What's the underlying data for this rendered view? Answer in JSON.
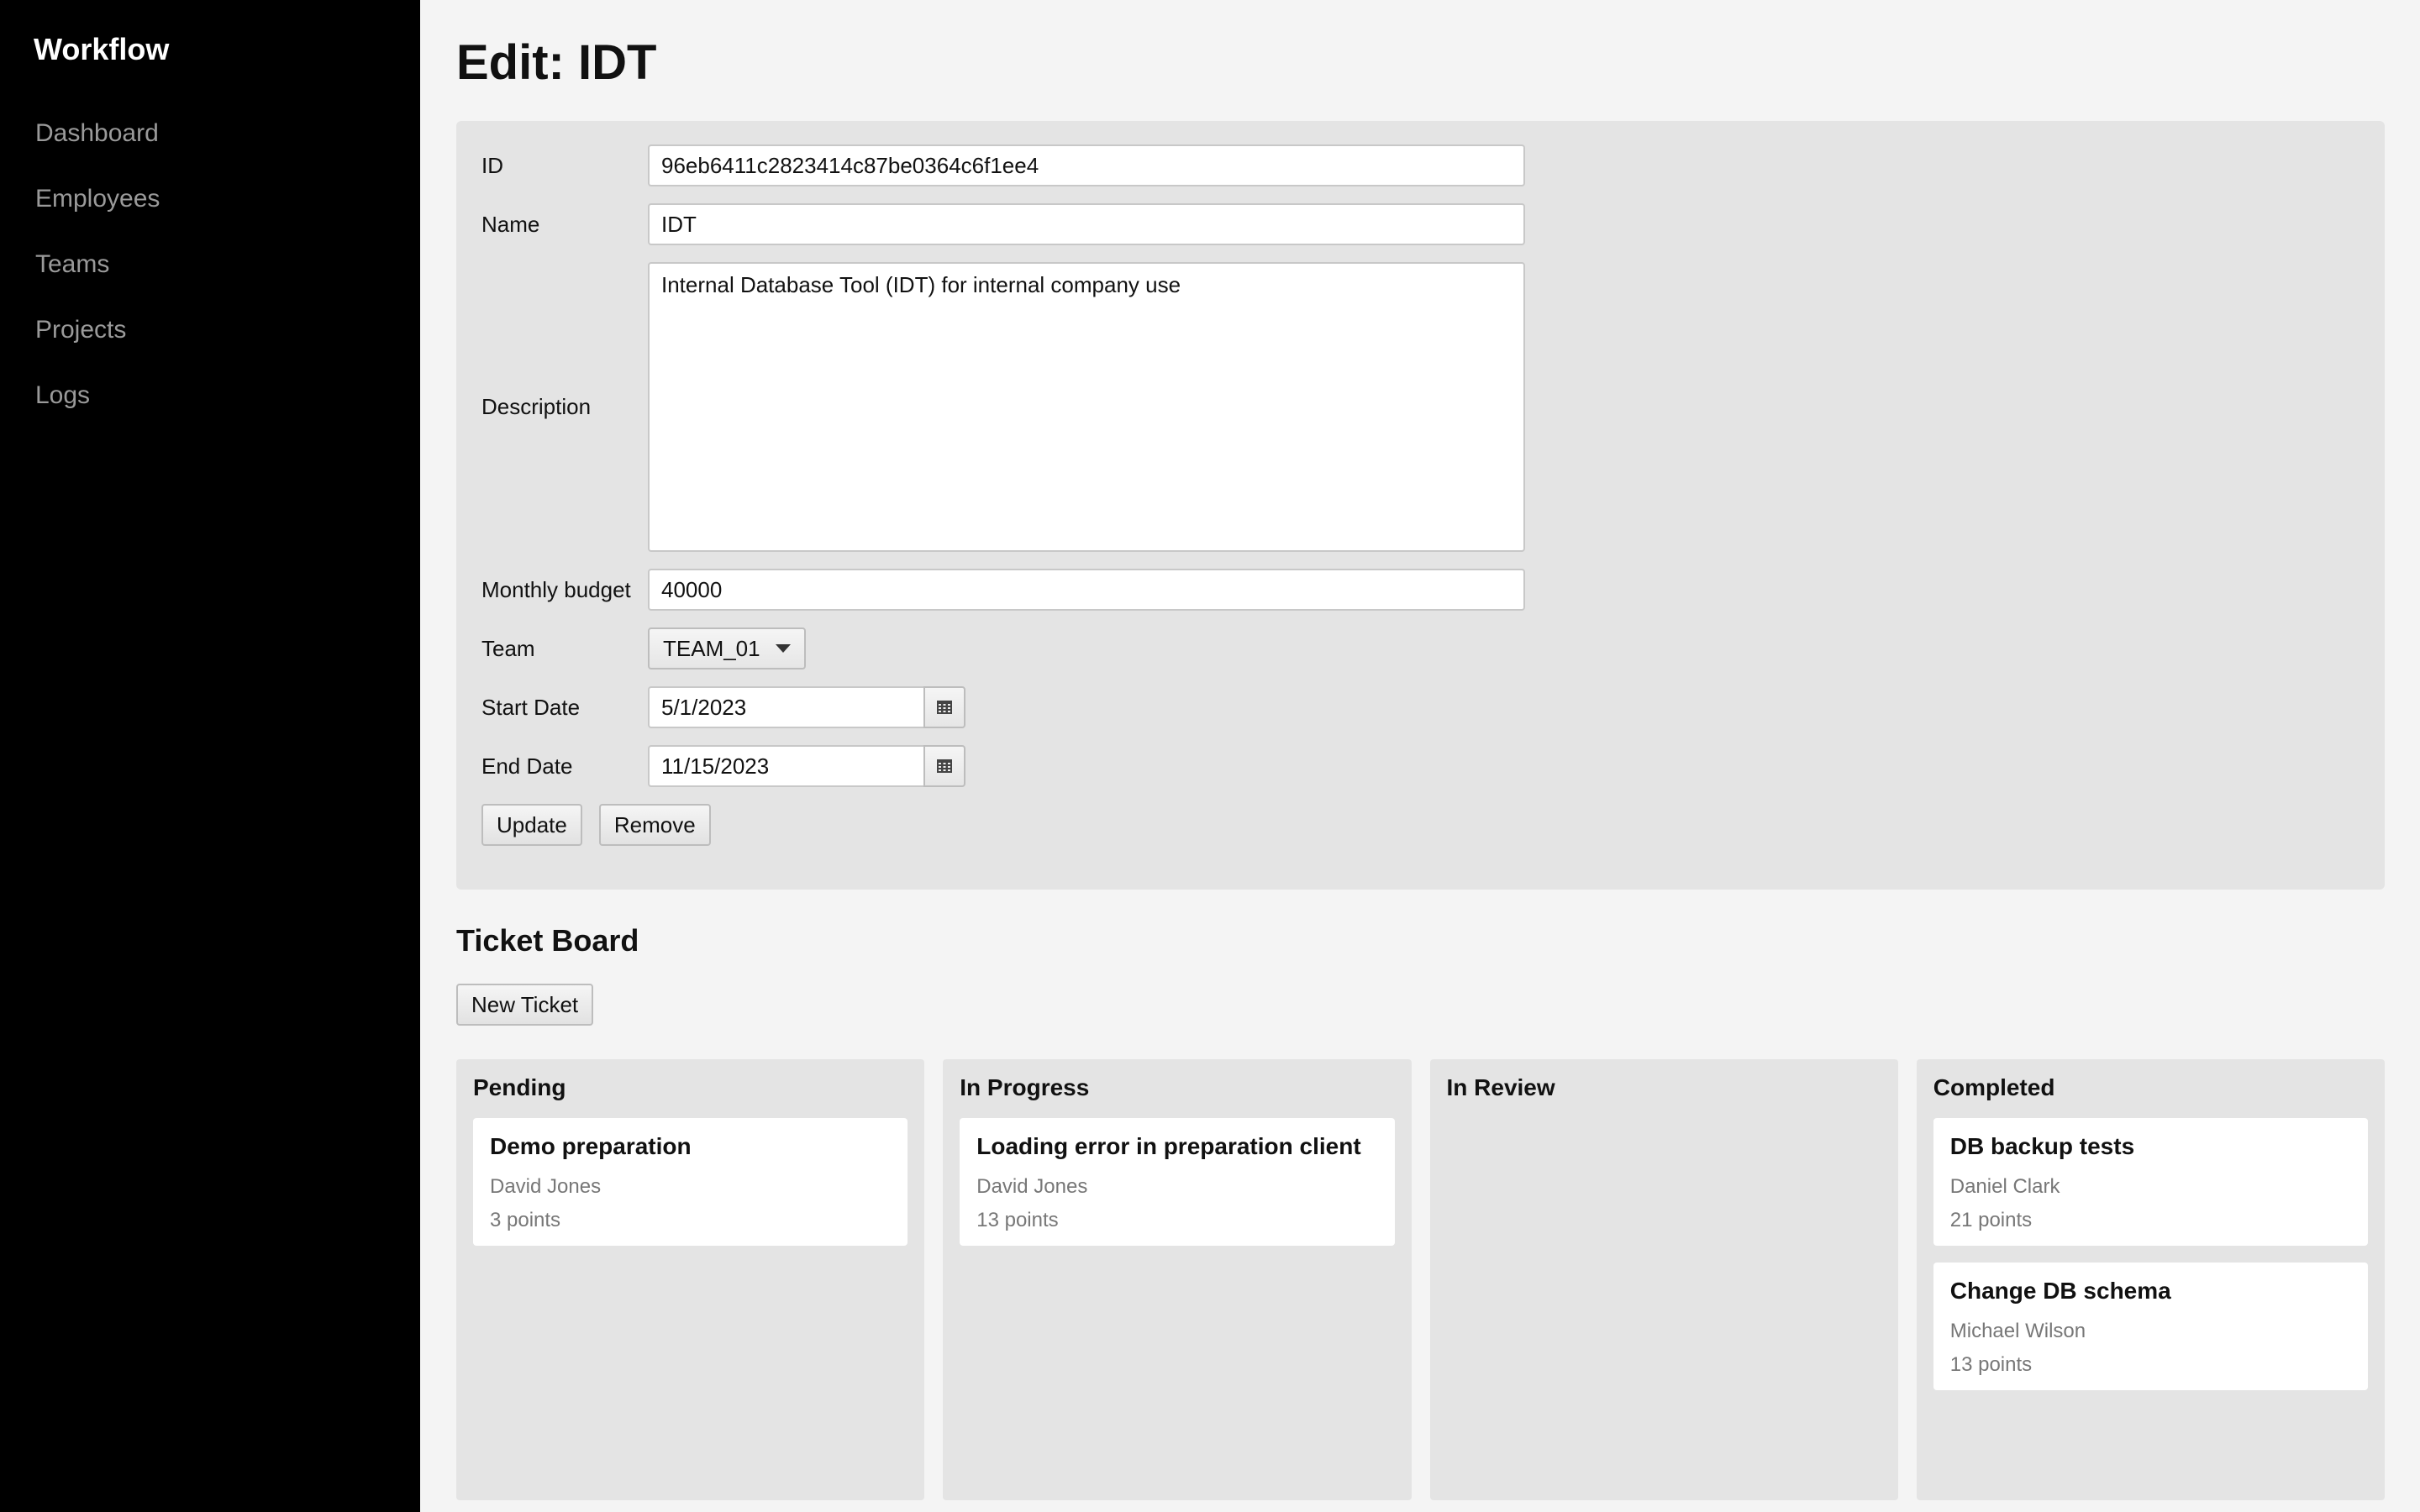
{
  "sidebar": {
    "brand": "Workflow",
    "items": [
      {
        "label": "Dashboard"
      },
      {
        "label": "Employees"
      },
      {
        "label": "Teams"
      },
      {
        "label": "Projects"
      },
      {
        "label": "Logs"
      }
    ]
  },
  "page": {
    "title": "Edit: IDT"
  },
  "form": {
    "id_label": "ID",
    "id_value": "96eb6411c2823414c87be0364c6f1ee4",
    "name_label": "Name",
    "name_value": "IDT",
    "description_label": "Description",
    "description_value": "Internal Database Tool (IDT) for internal company use",
    "budget_label": "Monthly budget",
    "budget_value": "40000",
    "team_label": "Team",
    "team_value": "TEAM_01",
    "start_label": "Start Date",
    "start_value": "5/1/2023",
    "end_label": "End Date",
    "end_value": "11/15/2023",
    "update_label": "Update",
    "remove_label": "Remove"
  },
  "board": {
    "title": "Ticket Board",
    "new_ticket_label": "New Ticket",
    "columns": [
      {
        "title": "Pending",
        "cards": [
          {
            "title": "Demo preparation",
            "assignee": "David Jones",
            "points": "3 points"
          }
        ]
      },
      {
        "title": "In Progress",
        "cards": [
          {
            "title": "Loading error in preparation client",
            "assignee": "David Jones",
            "points": "13 points"
          }
        ]
      },
      {
        "title": "In Review",
        "cards": []
      },
      {
        "title": "Completed",
        "cards": [
          {
            "title": "DB backup tests",
            "assignee": "Daniel Clark",
            "points": "21 points"
          },
          {
            "title": "Change DB schema",
            "assignee": "Michael Wilson",
            "points": "13 points"
          }
        ]
      }
    ]
  }
}
